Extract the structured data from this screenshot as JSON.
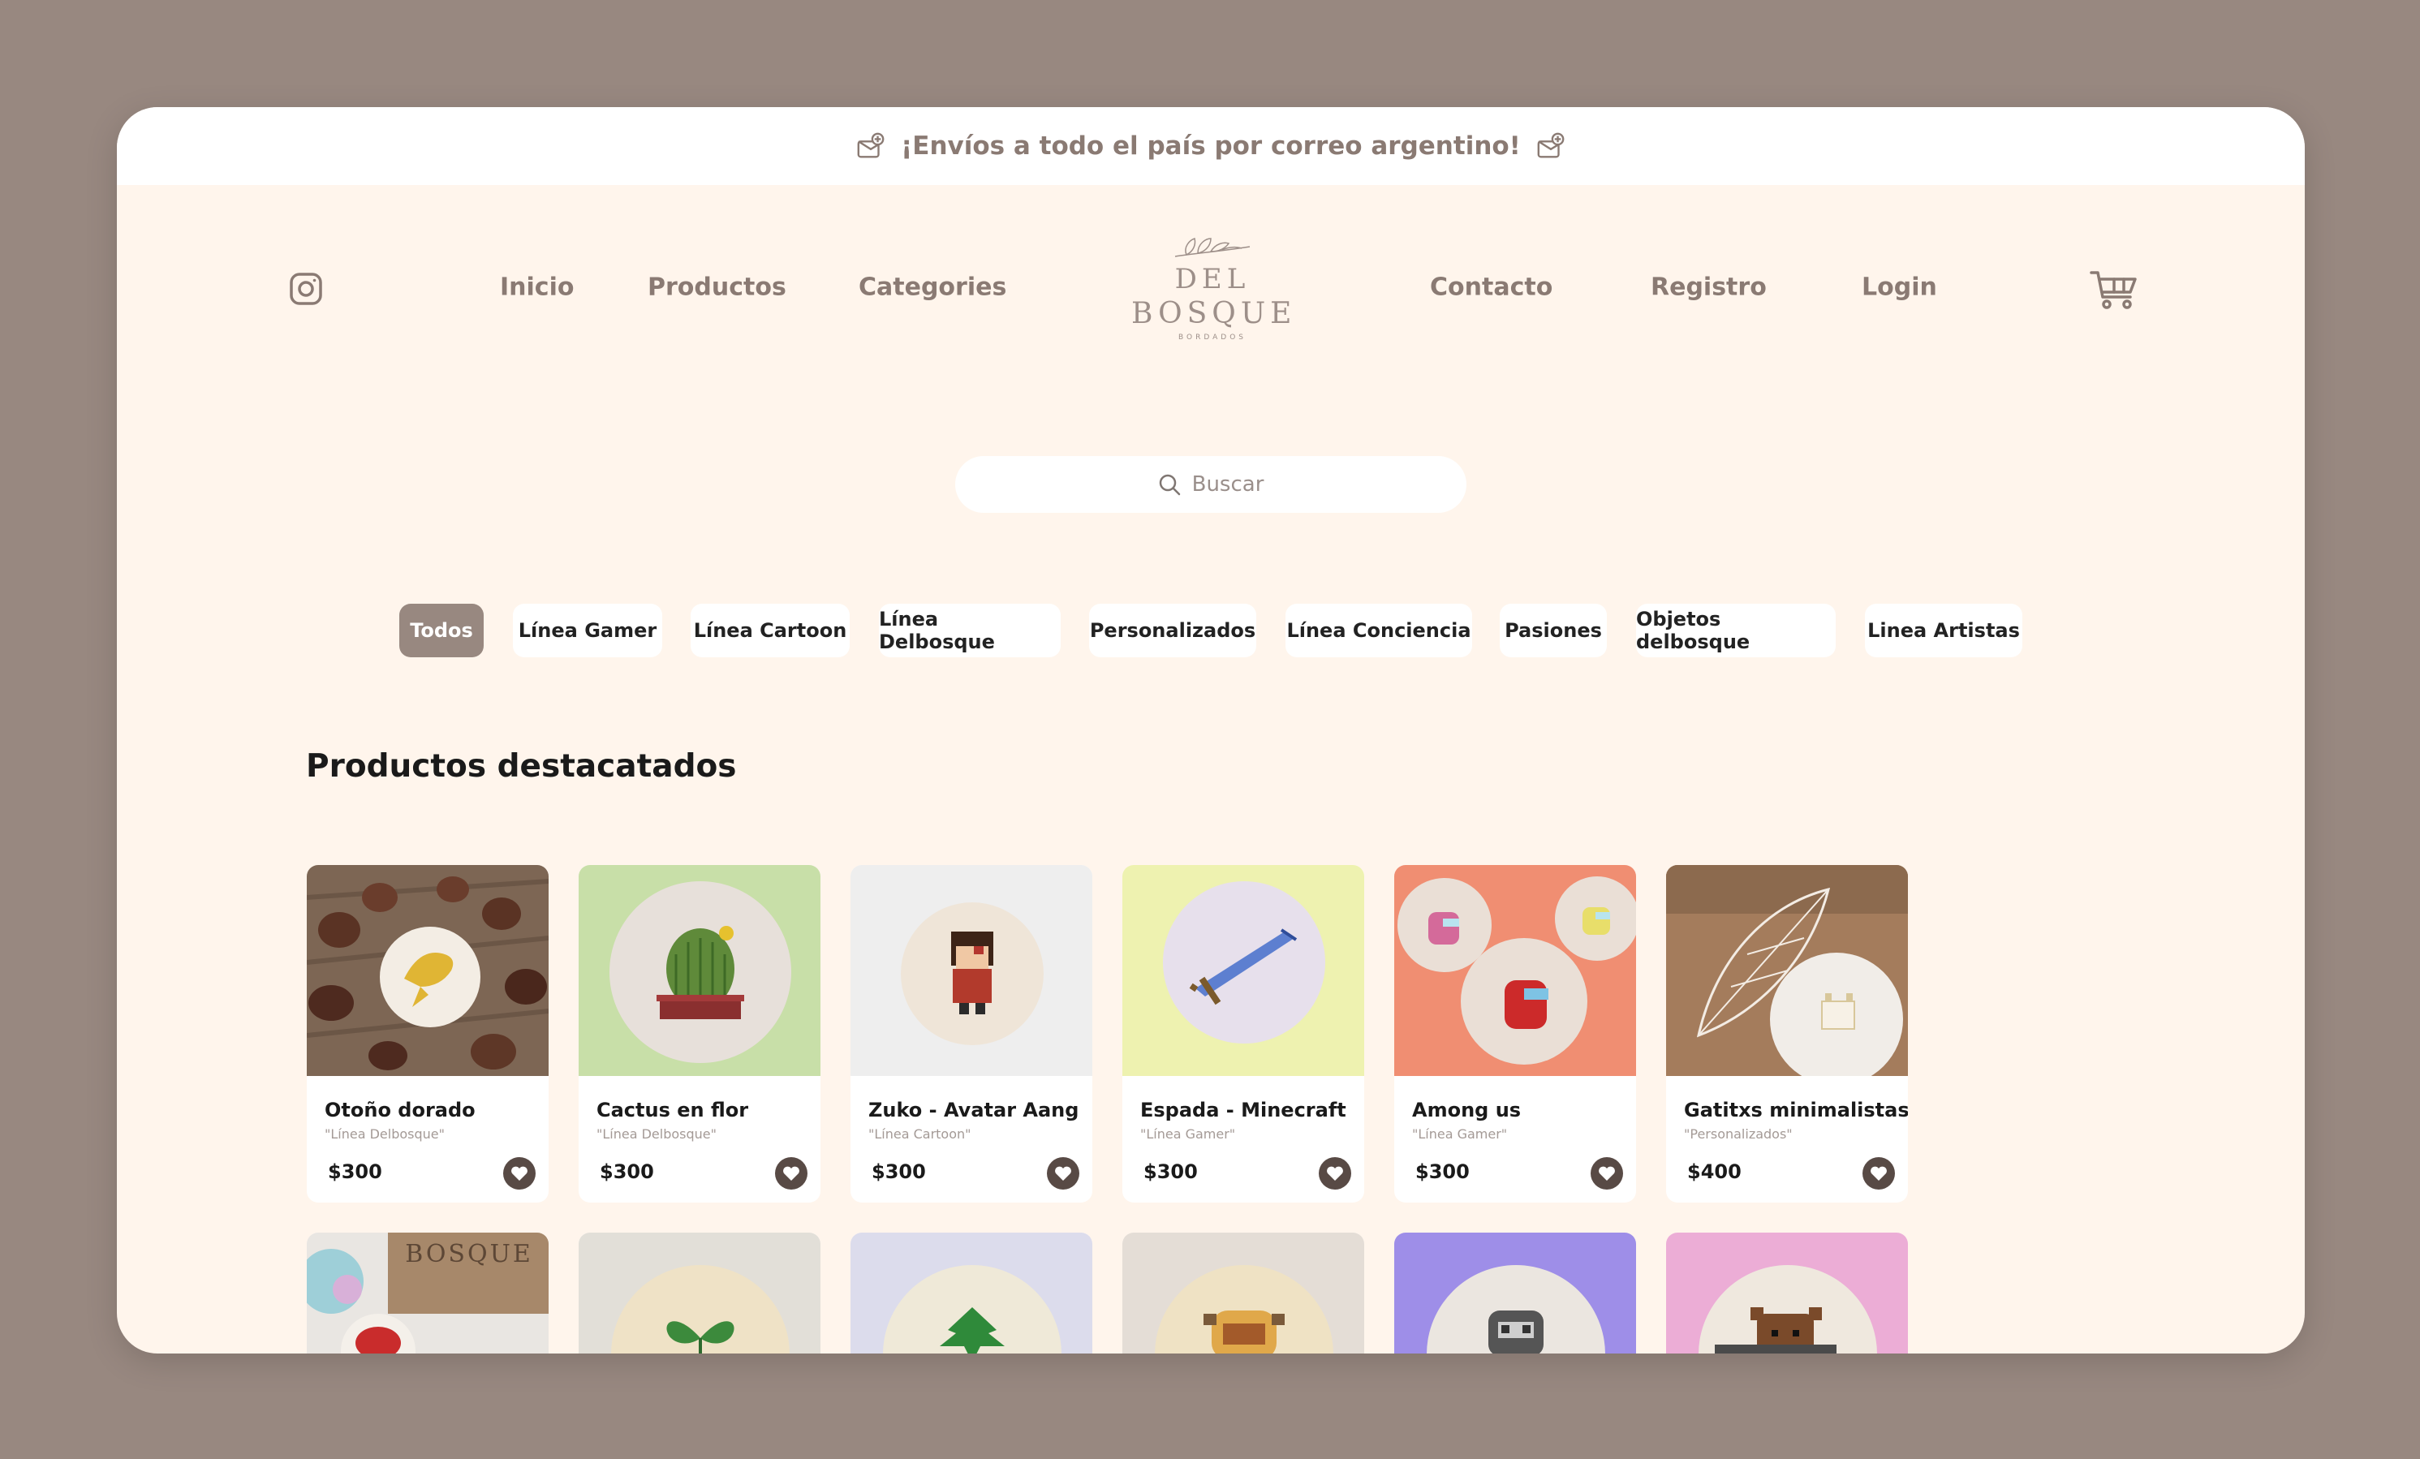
{
  "announcement": "¡Envíos a todo el país por correo argentino!",
  "nav": {
    "links": [
      "Inicio",
      "Productos",
      "Categories",
      "Contacto",
      "Registro",
      "Login"
    ],
    "logo": {
      "line1": "DEL",
      "line2": "BOSQUE",
      "line3": "BORDADOS"
    }
  },
  "search": {
    "placeholder": "Buscar"
  },
  "categories": [
    "Todos",
    "Línea Gamer",
    "Línea Cartoon",
    "Línea Delbosque",
    "Personalizados",
    "Línea Conciencia",
    "Pasiones",
    "Objetos delbosque",
    "Linea Artistas"
  ],
  "section_title": "Productos destacatados",
  "products": [
    {
      "name": "Otoño dorado",
      "category": "\"Línea Delbosque\"",
      "price": "$300"
    },
    {
      "name": "Cactus en flor",
      "category": "\"Línea Delbosque\"",
      "price": "$300"
    },
    {
      "name": "Zuko - Avatar Aang",
      "category": "\"Línea Cartoon\"",
      "price": "$300"
    },
    {
      "name": "Espada - Minecraft",
      "category": "\"Línea Gamer\"",
      "price": "$300"
    },
    {
      "name": "Among us",
      "category": "\"Línea Gamer\"",
      "price": "$300"
    },
    {
      "name": "Gatitxs minimalistas",
      "category": "\"Personalizados\"",
      "price": "$400"
    }
  ],
  "second_row_image_text": "BOSQUE",
  "colors": {
    "page_bg": "#988880",
    "content_bg": "#fff5ec",
    "active_chip": "#988880",
    "fav_button": "#584a45",
    "nav_text": "#8a7a73"
  },
  "icons": [
    "envelope-plus-icon",
    "instagram-icon",
    "cart-icon",
    "search-icon",
    "heart-icon"
  ]
}
